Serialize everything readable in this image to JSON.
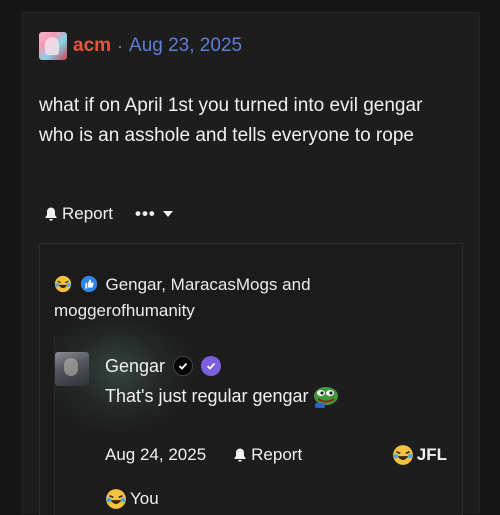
{
  "post": {
    "author": "acm",
    "separator": "·",
    "date": "Aug 23, 2025",
    "body": "what if on April 1st you turned into evil gengar who is an asshole and tells everyone to rope",
    "report_label": "Report",
    "more_label": "•••"
  },
  "quote": {
    "reactions_text": "Gengar, MaracasMogs and moggerofhumanity",
    "reply": {
      "author": "Gengar",
      "text": "That's just regular gengar",
      "date": "Aug 24, 2025",
      "report_label": "Report",
      "reaction_label": "JFL",
      "you_label": "You"
    }
  },
  "colors": {
    "author": "#e2583e",
    "date": "#5c7fd8",
    "badge_purple": "#7b5fe0",
    "background": "#161616"
  },
  "icons": [
    "bell-icon",
    "chevron-down-icon",
    "laughing-emoji-icon",
    "thumbs-up-icon",
    "verified-badge-icon",
    "pepe-emoji-icon"
  ]
}
